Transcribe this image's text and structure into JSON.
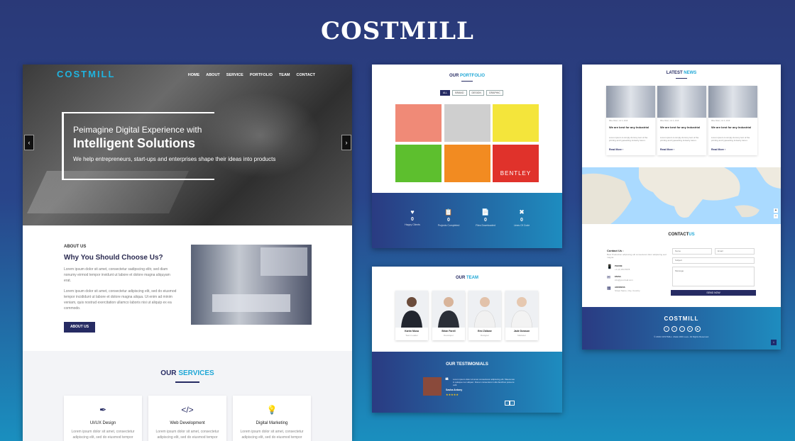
{
  "brand": "COSTMILL",
  "site": {
    "logo": "COSTMILL",
    "nav": [
      "HOME",
      "ABOUT",
      "SERVICE",
      "PORTFOLIO",
      "TEAM",
      "CONTACT"
    ],
    "hero": {
      "line1": "Peimagine Digital Experience with",
      "title": "Intelligent Solutions",
      "subtitle": "We help entrepreneurs, start-ups and enterprises shape their ideas into products"
    },
    "about": {
      "label": "ABOUT US",
      "title": "Why You Should Choose Us?",
      "p1": "Lorem ipsum dolor sit amet, consectetur sadipscing elitr, sed diam nonumy eirmod tempor invidunt ut labore et dolore magna aliquyam erat.",
      "p2": "Lorem ipsum dolor sit amet, consectetur adipiscing elit, sed do eiusmod tempor incididunt ut labore et dolore magna aliqua. Ut enim ad minim veniam, quis nostrud exercitation ullamco laboris nisi ut aliquip ex ea commodo.",
      "button": "ABOUT US"
    },
    "services": {
      "title_a": "OUR",
      "title_b": "SERVICES",
      "items": [
        {
          "icon": "pen-nib-icon",
          "glyph": "✒",
          "title": "UI/UX Design",
          "desc": "Lorem ipsum dolor sit amet, consectetur adipiscing elit, sed do eiusmod tempor"
        },
        {
          "icon": "code-icon",
          "glyph": "</>",
          "title": "Web Development",
          "desc": "Lorem ipsum dolor sit amet, consectetur adipiscing elit, sed do eiusmod tempor"
        },
        {
          "icon": "lightbulb-icon",
          "glyph": "💡",
          "title": "Digital Marketing",
          "desc": "Lorem ipsum dolor sit amet, consectetur adipiscing elit, sed do eiusmod tempor"
        }
      ]
    }
  },
  "portfolio": {
    "title_a": "OUR",
    "title_b": "PORTFOLIO",
    "filters": [
      "ALL",
      "BRAND",
      "DESIGN",
      "GRAPHIC"
    ],
    "tiles": [
      {
        "color": "#f08a77",
        "label": ""
      },
      {
        "color": "#cfcfcf",
        "label": ""
      },
      {
        "color": "#f4e53b",
        "label": ""
      },
      {
        "color": "#5dbf2e",
        "label": ""
      },
      {
        "color": "#f28b21",
        "label": ""
      },
      {
        "color": "#e0322b",
        "label": "BENTLEY"
      }
    ],
    "stats": [
      {
        "icon": "heart-icon",
        "glyph": "♥",
        "value": "0",
        "label": "Happy Clients"
      },
      {
        "icon": "clipboard-icon",
        "glyph": "📋",
        "value": "0",
        "label": "Projects Completed"
      },
      {
        "icon": "file-icon",
        "glyph": "📄",
        "value": "0",
        "label": "Files Downloaded"
      },
      {
        "icon": "tools-icon",
        "glyph": "✖",
        "value": "0",
        "label": "Lines Of Code"
      }
    ]
  },
  "team": {
    "title_a": "OUR",
    "title_b": "TEAM",
    "members": [
      {
        "name": "Karim Musa",
        "role": "Team Leader"
      },
      {
        "name": "Brian Farell",
        "role": "Developer"
      },
      {
        "name": "Emi Zidiane",
        "role": "Designer"
      },
      {
        "name": "Jade Dowson",
        "role": "Marketer"
      }
    ],
    "testimonials": {
      "title": "OUR TESTIMONIALS",
      "quote": "Lorem ipsum dolor sit amet consectetur adipiscing elit. Maecenas in quisque nec aliquet. Donec consectetur nulla faucibus posuere velit.",
      "author": "Sasha Antony",
      "stars": "★★★★★"
    }
  },
  "news": {
    "title_a": "LATEST",
    "title_b": "NEWS",
    "cards": [
      {
        "meta": "Mike Rider  |  Jul 3, 2019",
        "title": "We are best for any Industrial",
        "desc": "Lorem ipsum is simply dummy text of the printing and typesetting industry lorem.",
        "more": "Read More ›"
      },
      {
        "meta": "Mike Rider  |  Jul 3, 2019",
        "title": "We are best for any Industrial",
        "desc": "Lorem ipsum is simply dummy text of the printing and typesetting industry lorem.",
        "more": "Read More ›"
      },
      {
        "meta": "Mike Rider  |  Jul 3, 2019",
        "title": "We are best for any Industrial",
        "desc": "Lorem ipsum is simply dummy text of the printing and typesetting industry lorem.",
        "more": "Read More ›"
      }
    ],
    "contact": {
      "title_a": "CONTACT",
      "title_b": "US",
      "heading": "Contact Us :",
      "intro": "Best Production adipiscing elit consectetur dolor adipiscing sed magna.",
      "rows": [
        {
          "icon": "phone-icon",
          "glyph": "📱",
          "label": "PHONE",
          "value": "+1 (2) 234 5678"
        },
        {
          "icon": "mail-icon",
          "glyph": "✉",
          "label": "EMAIL",
          "value": "info@yourmail.com"
        },
        {
          "icon": "location-icon",
          "glyph": "▦",
          "label": "ADDRESS",
          "value": "Street Name, City, Country"
        }
      ],
      "name_ph": "Name",
      "email_ph": "Email",
      "subject_ph": "Subject",
      "message_ph": "Message",
      "send": "SEND NOW"
    },
    "footer": {
      "logo": "COSTMILL",
      "copyright": "© 2019 COSTMILL. Made With Love. All Rights Reserved."
    }
  }
}
